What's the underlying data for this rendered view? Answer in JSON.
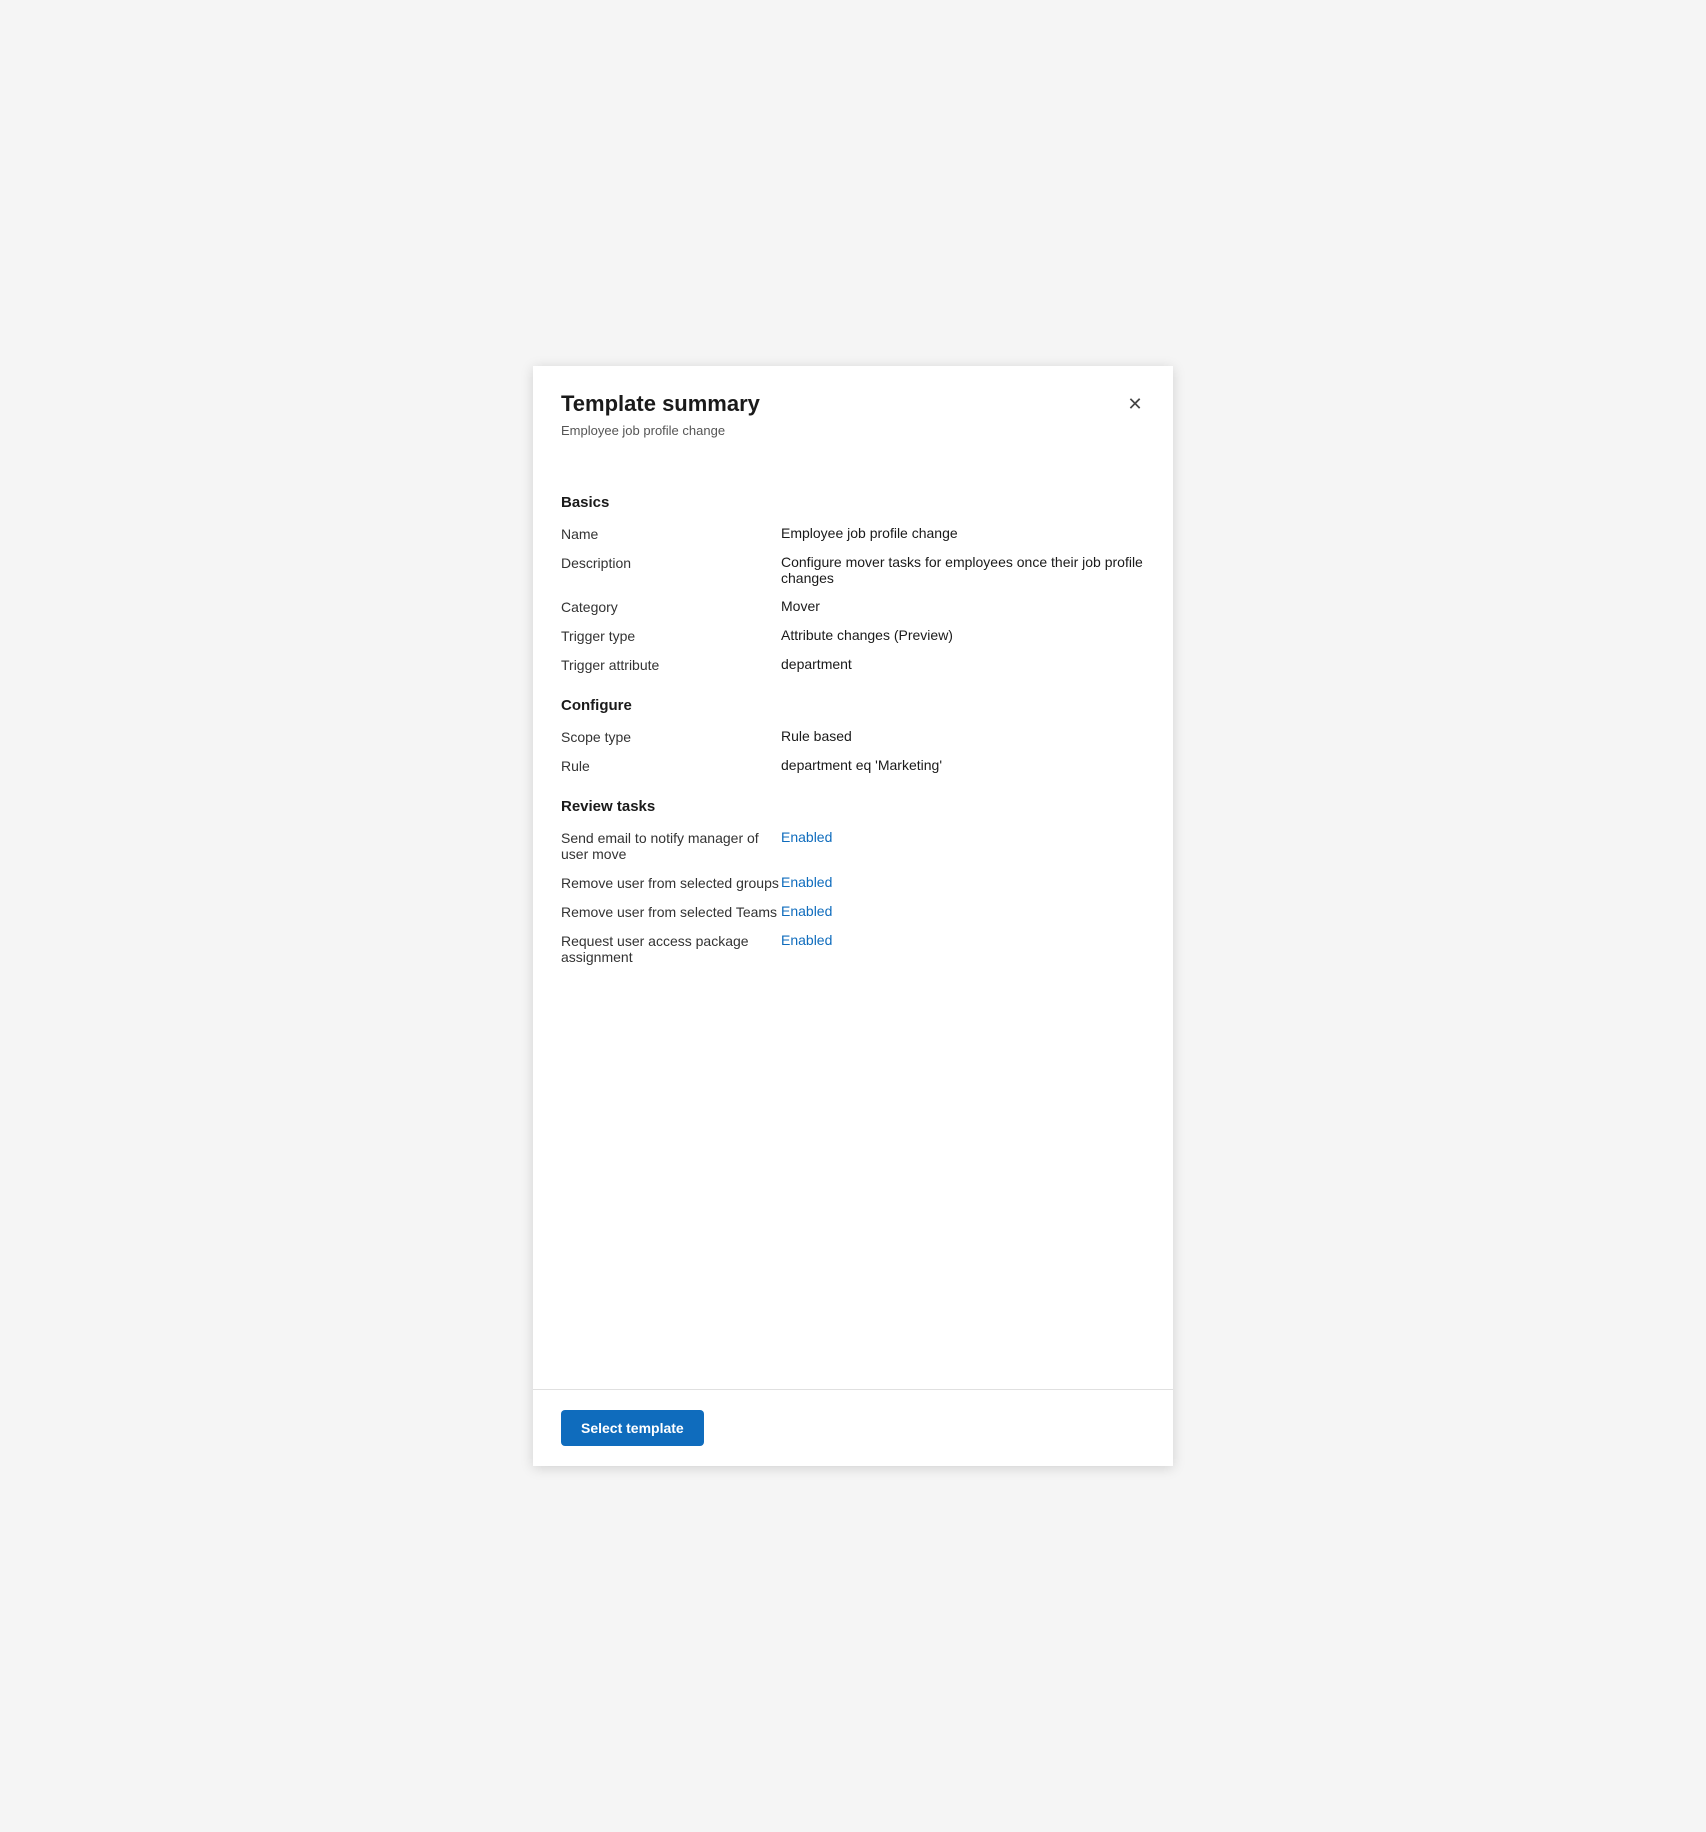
{
  "header": {
    "title": "Template summary",
    "subtitle": "Employee job profile change",
    "close_icon": "✕"
  },
  "sections": {
    "basics": {
      "heading": "Basics",
      "rows": [
        {
          "label": "Name",
          "value": "Employee job profile change",
          "enabled": false
        },
        {
          "label": "Description",
          "value": "Configure mover tasks for employees once their job profile changes",
          "enabled": false
        },
        {
          "label": "Category",
          "value": "Mover",
          "enabled": false
        },
        {
          "label": "Trigger type",
          "value": "Attribute changes (Preview)",
          "enabled": false
        },
        {
          "label": "Trigger attribute",
          "value": "department",
          "enabled": false
        }
      ]
    },
    "configure": {
      "heading": "Configure",
      "rows": [
        {
          "label": "Scope type",
          "value": "Rule based",
          "enabled": false
        },
        {
          "label": "Rule",
          "value": "department eq 'Marketing'",
          "enabled": false
        }
      ]
    },
    "review_tasks": {
      "heading": "Review tasks",
      "rows": [
        {
          "label": "Send email to notify manager of user move",
          "value": "Enabled",
          "enabled": true
        },
        {
          "label": "Remove user from selected groups",
          "value": "Enabled",
          "enabled": true
        },
        {
          "label": "Remove user from selected Teams",
          "value": "Enabled",
          "enabled": true
        },
        {
          "label": "Request user access package assignment",
          "value": "Enabled",
          "enabled": true
        }
      ]
    }
  },
  "footer": {
    "button_label": "Select template"
  }
}
